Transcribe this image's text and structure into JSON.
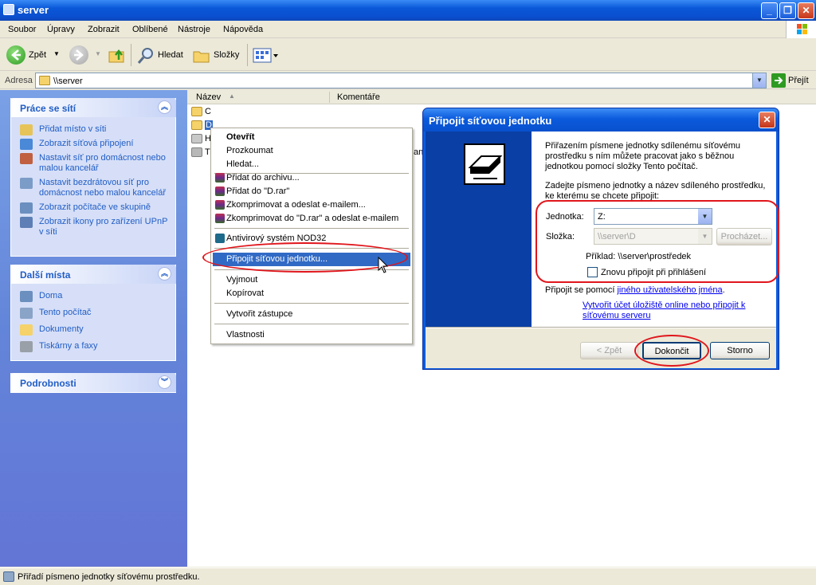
{
  "window": {
    "title": "server"
  },
  "menu": [
    "Soubor",
    "Úpravy",
    "Zobrazit",
    "Oblíbené",
    "Nástroje",
    "Nápověda"
  ],
  "toolbar": {
    "back": "Zpět",
    "search": "Hledat",
    "folders": "Složky"
  },
  "address": {
    "label": "Adresa",
    "value": "\\\\server",
    "go": "Přejít"
  },
  "left": {
    "network_tasks": {
      "title": "Práce se sítí",
      "items": [
        "Přidat místo v síti",
        "Zobrazit síťová připojení",
        "Nastavit síť pro domácnost nebo malou kancelář",
        "Nastavit bezdrátovou síť pro domácnost nebo malou kancelář",
        "Zobrazit počítače ve skupině",
        "Zobrazit ikony pro zařízení UPnP v síti"
      ]
    },
    "other_places": {
      "title": "Další místa",
      "items": [
        "Doma",
        "Tento počítač",
        "Dokumenty",
        "Tiskárny a faxy"
      ]
    },
    "details": {
      "title": "Podrobnosti"
    }
  },
  "columns": {
    "name": "Název",
    "comment": "Komentáře"
  },
  "files": [
    "C",
    "D",
    "H",
    "Ti"
  ],
  "file_comment_fragment": "an",
  "context_menu": {
    "items": [
      "Otevřít",
      "Prozkoumat",
      "Hledat...",
      "Přidat do archivu...",
      "Přidat do \"D.rar\"",
      "Zkomprimovat a odeslat e-mailem...",
      "Zkomprimovat do \"D.rar\" a odeslat e-mailem",
      "Antivirový systém NOD32",
      "Připojit síťovou jednotku...",
      "Vyjmout",
      "Kopírovat",
      "Vytvořit zástupce",
      "Vlastnosti"
    ]
  },
  "dialog": {
    "title": "Připojit síťovou jednotku",
    "intro": "Přiřazením písmene jednotky sdílenému síťovému prostředku s ním můžete pracovat jako s běžnou jednotkou pomocí složky Tento počítač.",
    "instruction": "Zadejte písmeno jednotky a název sdíleného prostředku, ke kterému se chcete připojit:",
    "drive_label": "Jednotka:",
    "drive_value": "Z:",
    "folder_label": "Složka:",
    "folder_value": "\\\\server\\D",
    "browse": "Procházet...",
    "example": "Příklad: \\\\server\\prostředek",
    "reconnect": "Znovu připojit při přihlášení",
    "connect_using_prefix": "Připojit se pomocí ",
    "connect_using_link": "jiného uživatelského jména",
    "connect_using_suffix": ".",
    "online_link": "Vytvořit účet úložiště online nebo připojit k síťovému serveru",
    "back": "< Zpět",
    "finish": "Dokončit",
    "cancel": "Storno"
  },
  "status": {
    "text": "Přiřadí písmeno jednotky síťovému prostředku."
  },
  "colors": {
    "accent": "#215dc6",
    "highlight": "#316ac5",
    "annotation": "#e0161c"
  }
}
